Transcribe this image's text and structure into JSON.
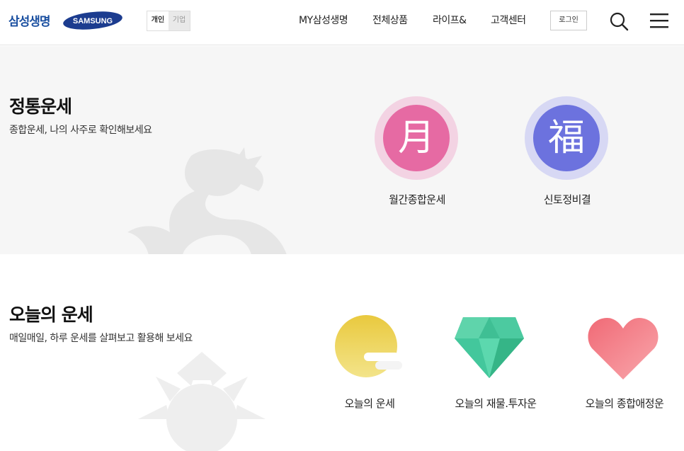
{
  "header": {
    "brand": "삼성생명",
    "samsung_logo": "SAMSUNG",
    "segments": [
      "개인",
      "기업"
    ],
    "nav": [
      "MY삼성생명",
      "전체상품",
      "라이프&",
      "고객센터"
    ],
    "login": "로그인"
  },
  "section1": {
    "title": "정통운세",
    "subtitle": "종합운세, 나의 사주로 확인해보세요",
    "items": [
      {
        "label": "월간종합운세",
        "glyph": "月",
        "color": "#e4579a"
      },
      {
        "label": "신토정비결",
        "glyph": "福",
        "color": "#5d63d6"
      }
    ]
  },
  "section2": {
    "title": "오늘의 운세",
    "subtitle": "매일매일, 하루 운세를 살펴보고 활용해 보세요",
    "items": [
      {
        "label": "오늘의 운세",
        "icon": "sun-cloud-icon"
      },
      {
        "label": "오늘의 재물.투자운",
        "icon": "diamond-icon"
      },
      {
        "label": "오늘의 종합애정운",
        "icon": "heart-icon"
      }
    ]
  }
}
